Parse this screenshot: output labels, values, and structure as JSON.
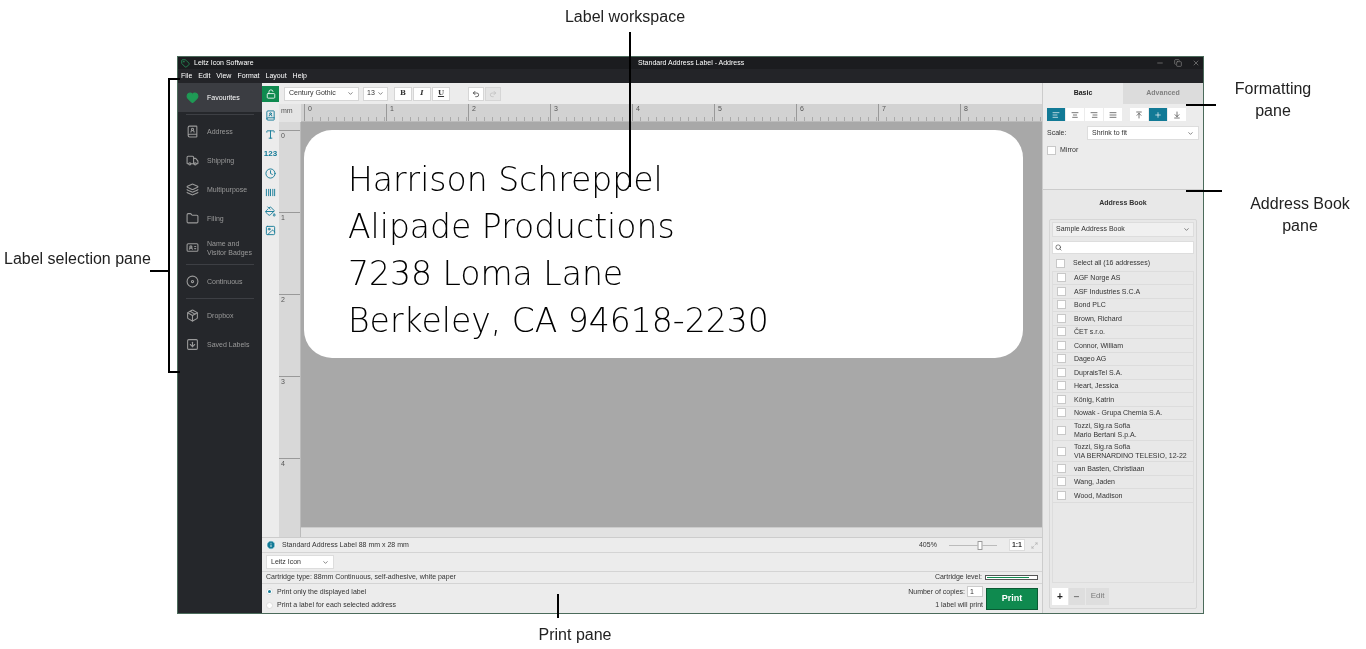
{
  "annotations": [
    {
      "kind": "workspace",
      "text": "Label workspace"
    },
    {
      "kind": "formatting",
      "text": "Formatting pane"
    },
    {
      "kind": "addressbook",
      "text": "Address Book pane"
    },
    {
      "kind": "selection",
      "text": "Label selection pane"
    },
    {
      "kind": "print",
      "text": "Print pane"
    }
  ],
  "window": {
    "app_name": "Leitz Icon Software",
    "title": "Standard Address Label - Address"
  },
  "menu": [
    "File",
    "Edit",
    "View",
    "Format",
    "Layout",
    "Help"
  ],
  "sidebar": {
    "items": [
      {
        "label": "Favourites",
        "kind": "heart",
        "selected": true,
        "divider_after": true
      },
      {
        "label": "Address",
        "kind": "address",
        "selected": false,
        "divider_after": false
      },
      {
        "label": "Shipping",
        "kind": "shipping",
        "selected": false,
        "divider_after": false
      },
      {
        "label": "Multipurpose",
        "kind": "multipurpose",
        "selected": false,
        "divider_after": false
      },
      {
        "label": "Filing",
        "kind": "filing",
        "selected": false,
        "divider_after": false
      },
      {
        "label": "Name and Visitor Badges",
        "kind": "badge",
        "selected": false,
        "divider_after": true
      },
      {
        "label": "Continuous",
        "kind": "continuous",
        "selected": false,
        "divider_after": true
      },
      {
        "label": "Dropbox",
        "kind": "dropbox",
        "selected": false,
        "divider_after": false
      },
      {
        "label": "Saved Labels",
        "kind": "saved",
        "selected": false,
        "divider_after": false
      }
    ]
  },
  "tools": [
    {
      "kind": "lock"
    },
    {
      "kind": "address"
    },
    {
      "kind": "text"
    },
    {
      "kind": "number",
      "label": "123"
    },
    {
      "kind": "clock"
    },
    {
      "kind": "barcode"
    },
    {
      "kind": "shape"
    },
    {
      "kind": "image"
    }
  ],
  "toolbar": {
    "font": "Century Gothic",
    "size": "13",
    "styles": [
      "B",
      "I",
      "U"
    ],
    "history": [
      {
        "kind": "undo",
        "disabled": false
      },
      {
        "kind": "redo",
        "disabled": true
      }
    ]
  },
  "ruler": {
    "unit": "mm",
    "x_ticks": [
      "0",
      "1",
      "2",
      "3",
      "4",
      "5",
      "6",
      "7",
      "8"
    ],
    "y_ticks": [
      "0",
      "1",
      "2",
      "3",
      "4"
    ]
  },
  "label": {
    "lines": [
      "Harrison Schreppel",
      "Alipade Productions",
      "7238 Loma Lane",
      "Berkeley, CA 94618-2230"
    ]
  },
  "status": {
    "info": "Standard Address Label 88 mm x 28 mm",
    "zoom": "405%",
    "zoom_level": {
      "level": 0.65
    },
    "actual_size": "1:1"
  },
  "print": {
    "printer": "Leitz Icon",
    "cartridge_type": "Cartridge type: 88mm Continuous, self-adhesive, white paper",
    "cartridge_level_label": "Cartridge level:",
    "cartridge": {
      "level": 0.85
    },
    "options": [
      {
        "label": "Print only the displayed label",
        "selected": true
      },
      {
        "label": "Print a label for each selected address",
        "selected": false
      }
    ],
    "copies_label": "Number of copies:",
    "copies": "1",
    "will_print": "1 label will print",
    "button": "Print"
  },
  "formatting": {
    "tabs": [
      {
        "label": "Basic",
        "selected": true
      },
      {
        "label": "Advanced",
        "selected": false
      }
    ],
    "h_align": [
      {
        "kind": "left",
        "selected": true
      },
      {
        "kind": "center",
        "selected": false
      },
      {
        "kind": "right",
        "selected": false
      },
      {
        "kind": "justify",
        "selected": false
      }
    ],
    "v_align": [
      {
        "kind": "top",
        "selected": false
      },
      {
        "kind": "middle",
        "selected": true
      },
      {
        "kind": "bottom",
        "selected": false
      }
    ],
    "scale_label": "Scale:",
    "scale": "Shrink to fit",
    "mirror": {
      "label": "Mirror",
      "checked": false
    }
  },
  "address_book": {
    "title": "Address Book",
    "book": "Sample Address Book",
    "select_all": {
      "label": "Select all (16 addresses)",
      "checked": false
    },
    "entries": [
      {
        "lines": [
          "AGF Norge AS"
        ],
        "checked": false
      },
      {
        "lines": [
          "ASF Industries S.C.A"
        ],
        "checked": false
      },
      {
        "lines": [
          "Bond PLC"
        ],
        "checked": false
      },
      {
        "lines": [
          "Brown, Richard"
        ],
        "checked": false
      },
      {
        "lines": [
          "ČET s.r.o."
        ],
        "checked": false
      },
      {
        "lines": [
          "Connor, William"
        ],
        "checked": false
      },
      {
        "lines": [
          "Dageo AG"
        ],
        "checked": false
      },
      {
        "lines": [
          "DupraisTel S.A."
        ],
        "checked": false
      },
      {
        "lines": [
          "Heart, Jessica"
        ],
        "checked": false
      },
      {
        "lines": [
          "König, Katrin"
        ],
        "checked": false
      },
      {
        "lines": [
          "Nowak - Grupa Chemia S.A."
        ],
        "checked": false
      },
      {
        "lines": [
          "Tozzi, Sig.ra Sofia",
          "Mario Bertani S.p.A."
        ],
        "checked": false
      },
      {
        "lines": [
          "Tozzi, Sig.ra Sofia",
          "VIA BERNARDINO TELESIO, 12-22"
        ],
        "checked": false
      },
      {
        "lines": [
          "van Basten, Christiaan"
        ],
        "checked": false
      },
      {
        "lines": [
          "Wang, Jaden"
        ],
        "checked": false
      },
      {
        "lines": [
          "Wood, Madison"
        ],
        "checked": false
      }
    ],
    "buttons": [
      {
        "kind": "add",
        "label": "+",
        "disabled": false
      },
      {
        "kind": "remove",
        "label": "−",
        "disabled": true
      },
      {
        "kind": "edit",
        "label": "Edit",
        "disabled": true
      }
    ]
  }
}
